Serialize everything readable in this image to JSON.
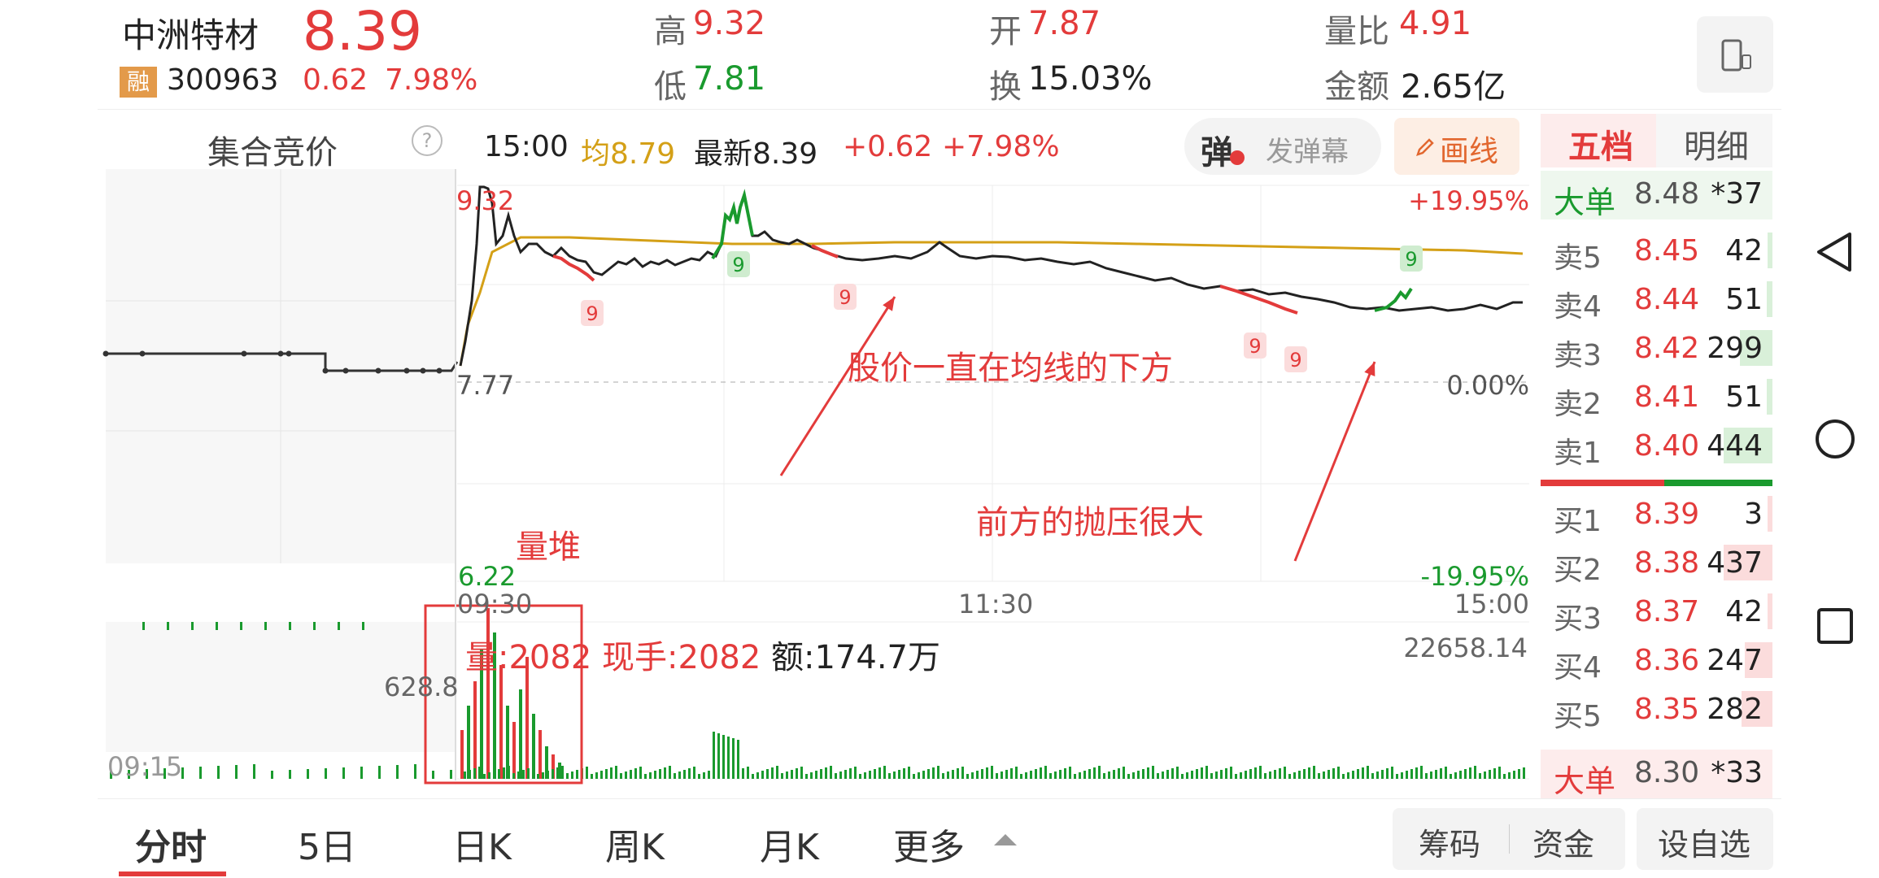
{
  "stock": {
    "name": "中洲特材",
    "price": "8.39",
    "tag": "融",
    "code": "300963",
    "change": "0.62",
    "change_pct": "7.98%"
  },
  "stats": {
    "high_label": "高",
    "high": "9.32",
    "low_label": "低",
    "low": "7.81",
    "open_label": "开",
    "open": "7.87",
    "turnover_label": "换",
    "turnover": "15.03%",
    "vol_ratio_label": "量比",
    "vol_ratio": "4.91",
    "amount_label": "金额",
    "amount": "2.65亿"
  },
  "auction": {
    "label": "集合竞价",
    "help": "?"
  },
  "infobar": {
    "time": "15:00",
    "avg_label": "均8.79",
    "latest_label": "最新8.39",
    "change": "+0.62",
    "change_pct": "+7.98%"
  },
  "danmaku": {
    "icon_label": "弹",
    "send_label": "发弹幕"
  },
  "draw_line": {
    "label": "画线"
  },
  "chart_labels": {
    "high_price": "9.32",
    "base_price": "7.77",
    "low_price": "6.22",
    "pct_top": "+19.95%",
    "pct_zero": "0.00%",
    "pct_bottom": "-19.95%",
    "t_start": "09:30",
    "t_mid": "11:30",
    "t_end": "15:00",
    "vol_max_label": "22658.14",
    "auction_vol_label": "628.8",
    "auction_time": "09:15",
    "signal": "9"
  },
  "annotations": {
    "below_avg": "股价一直在均线的下方",
    "pressure": "前方的抛压很大",
    "volume_pile": "量堆"
  },
  "volume_info": {
    "vol": "量:2082",
    "cur_hand": "现手:2082",
    "amount": "额:174.7万"
  },
  "orderbook": {
    "tabs": [
      "五档",
      "明细"
    ],
    "big_sell": {
      "label": "大单",
      "price": "8.48",
      "qty": "*37"
    },
    "asks": [
      {
        "label": "卖5",
        "price": "8.45",
        "qty": "42",
        "depth": 0.06
      },
      {
        "label": "卖4",
        "price": "8.44",
        "qty": "51",
        "depth": 0.07
      },
      {
        "label": "卖3",
        "price": "8.42",
        "qty": "299",
        "depth": 0.4
      },
      {
        "label": "卖2",
        "price": "8.41",
        "qty": "51",
        "depth": 0.07
      },
      {
        "label": "卖1",
        "price": "8.40",
        "qty": "444",
        "depth": 0.6
      }
    ],
    "bids": [
      {
        "label": "买1",
        "price": "8.39",
        "qty": "3",
        "depth": 0.01
      },
      {
        "label": "买2",
        "price": "8.38",
        "qty": "437",
        "depth": 0.6
      },
      {
        "label": "买3",
        "price": "8.37",
        "qty": "42",
        "depth": 0.06
      },
      {
        "label": "买4",
        "price": "8.36",
        "qty": "247",
        "depth": 0.34
      },
      {
        "label": "买5",
        "price": "8.35",
        "qty": "282",
        "depth": 0.38
      }
    ],
    "big_buy": {
      "label": "大单",
      "price": "8.30",
      "qty": "*33"
    }
  },
  "bottom_tabs": [
    "分时",
    "5日",
    "日K",
    "周K",
    "月K",
    "更多"
  ],
  "bottom_buttons": {
    "chips": "筹码",
    "funds": "资金",
    "watchlist": "设自选"
  },
  "colors": {
    "up": "#e33b3b",
    "down": "#1a9a2e",
    "avg": "#d4a017",
    "price": "#222222"
  }
}
